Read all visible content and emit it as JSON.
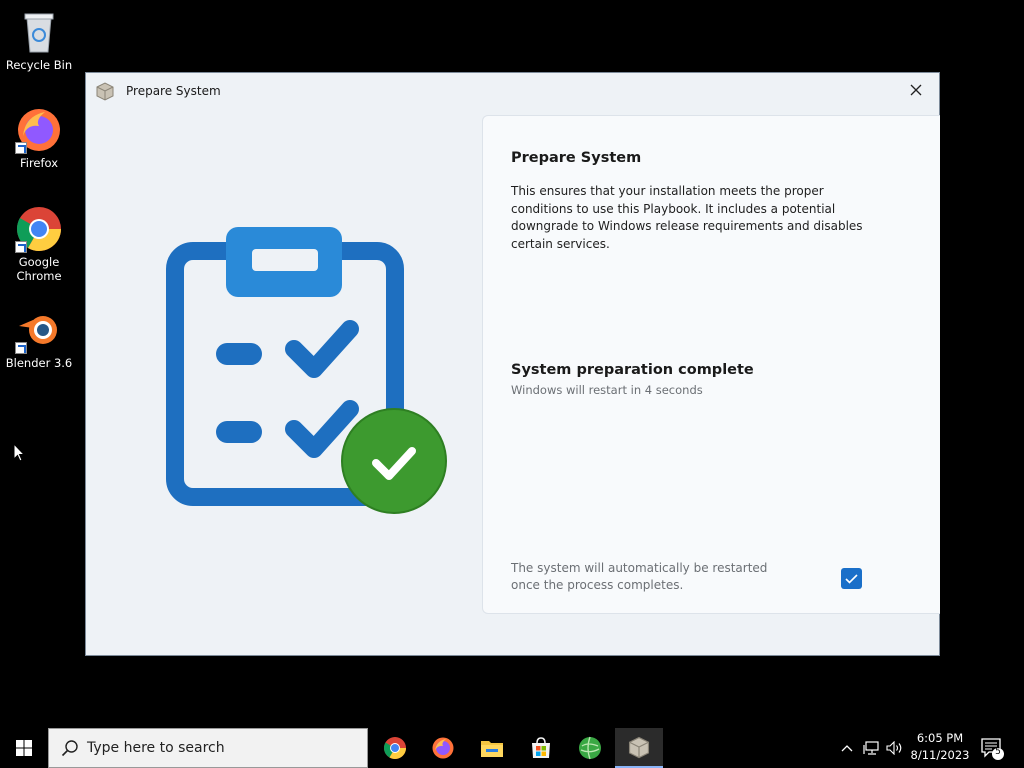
{
  "desktop": {
    "icons": [
      {
        "label": "Recycle Bin",
        "icon": "recycle-bin-icon"
      },
      {
        "label": "Firefox",
        "icon": "firefox-icon"
      },
      {
        "label": "Google Chrome",
        "icon": "chrome-icon"
      },
      {
        "label": "Blender 3.6",
        "icon": "blender-icon"
      }
    ]
  },
  "window": {
    "title": "Prepare System",
    "panel": {
      "heading": "Prepare System",
      "description": "This ensures that your installation meets the proper conditions to use this Playbook. It includes a potential downgrade to Windows release requirements and disables certain services.",
      "status_title": "System preparation complete",
      "status_subtitle": "Windows will restart in 4 seconds",
      "auto_restart_note": "The system will automatically be restarted once the process completes.",
      "auto_restart_checked": true
    },
    "colors": {
      "accent": "#1a6fc9",
      "success": "#3d9a2f"
    }
  },
  "taskbar": {
    "search_placeholder": "Type here to search",
    "apps": [
      "chrome-icon",
      "firefox-icon",
      "file-explorer-icon",
      "microsoft-store-icon",
      "globe-app-icon",
      "prepare-system-icon"
    ],
    "time": "6:05 PM",
    "date": "8/11/2023",
    "notification_count": "5"
  }
}
